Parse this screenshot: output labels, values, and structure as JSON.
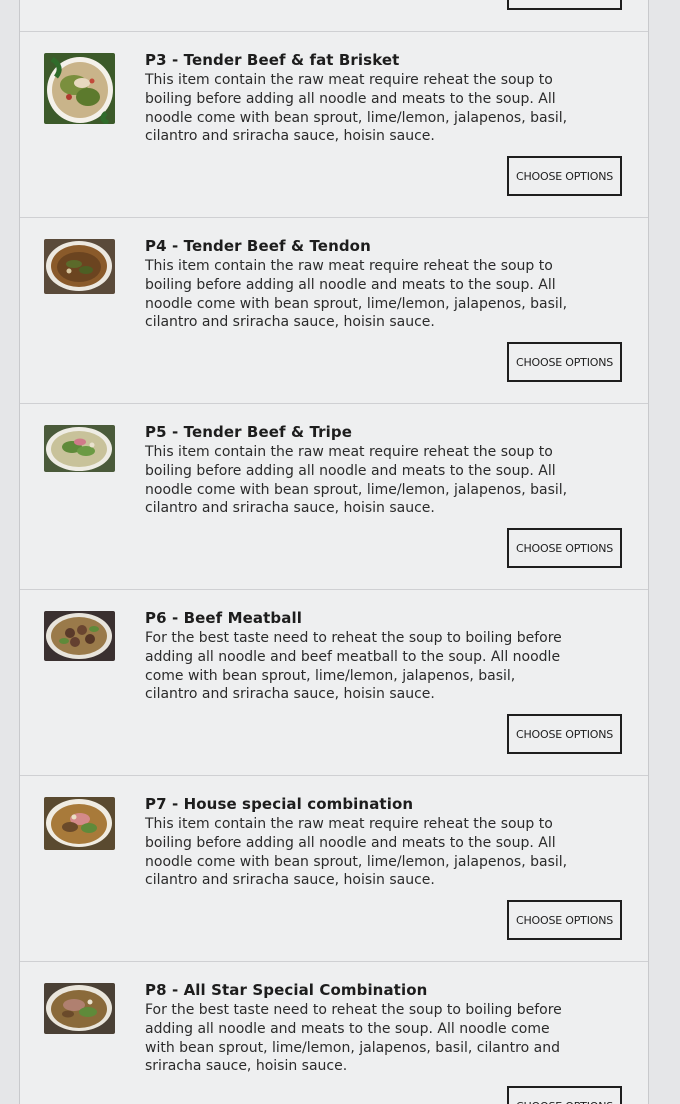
{
  "choose_options_label": "Choose Options",
  "items": [
    {
      "title": "",
      "description": ""
    },
    {
      "title": "P3 - Tender Beef & fat Brisket",
      "description": "This item contain the raw meat require reheat the soup to boiling before adding all noodle and meats to the soup. All noodle come with bean sprout, lime/lemon, jalapenos, basil, cilantro and sriracha sauce, hoisin sauce."
    },
    {
      "title": "P4 - Tender Beef & Tendon",
      "description": "This item contain the raw meat require reheat the soup to boiling before adding all noodle and meats to the soup. All noodle come with bean sprout, lime/lemon, jalapenos, basil, cilantro and sriracha sauce, hoisin sauce."
    },
    {
      "title": "P5 - Tender Beef & Tripe",
      "description": "This item contain the raw meat require reheat the soup to boiling before adding all noodle and meats to the soup. All noodle come with bean sprout, lime/lemon, jalapenos, basil, cilantro and sriracha sauce, hoisin sauce."
    },
    {
      "title": "P6 - Beef Meatball",
      "description": "For the best taste need to reheat the soup to boiling before adding all noodle and beef meatball to the soup. All noodle come with bean sprout, lime/lemon, jalapenos, basil, cilantro and sriracha sauce, hoisin sauce."
    },
    {
      "title": "P7 - House special combination",
      "description": "This item contain the raw meat require reheat the soup to boiling before adding all noodle and meats to the soup. All noodle come with bean sprout, lime/lemon, jalapenos, basil, cilantro and sriracha sauce, hoisin sauce."
    },
    {
      "title": "P8 - All Star Special Combination",
      "description": "For the best taste need to reheat the soup to boiling before adding all noodle and meats to the soup. All noodle come with bean sprout, lime/lemon, jalapenos, basil, cilantro and sriracha sauce, hoisin sauce."
    }
  ]
}
